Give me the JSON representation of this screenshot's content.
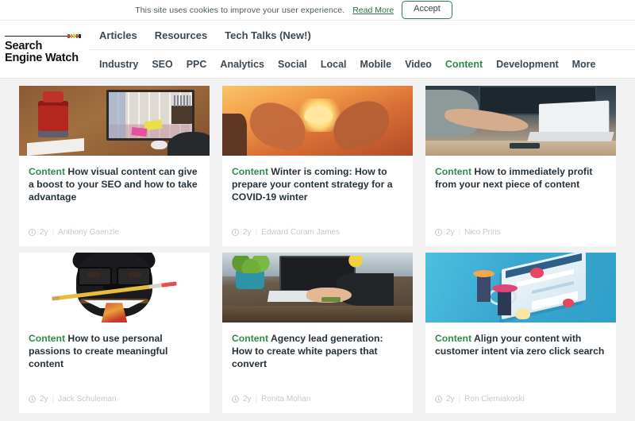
{
  "cookie_bar": {
    "message": "This site uses cookies to improve your user experience.",
    "read_more_label": "Read More",
    "accept_label": "Accept",
    "accent_color": "#2c6e49"
  },
  "header": {
    "logo": {
      "line1": "Search",
      "line2": "Engine Watch",
      "pip_colors": [
        "#d8392c",
        "#e8a02a",
        "#e8c92a",
        "#d8392c",
        "#2b2b2b"
      ]
    },
    "primary_nav": [
      {
        "label": "Articles"
      },
      {
        "label": "Resources"
      },
      {
        "label": "Tech Talks (New!)"
      }
    ],
    "secondary_nav": [
      {
        "label": "Industry",
        "active": false
      },
      {
        "label": "SEO",
        "active": false
      },
      {
        "label": "PPC",
        "active": false
      },
      {
        "label": "Analytics",
        "active": false
      },
      {
        "label": "Social",
        "active": false
      },
      {
        "label": "Local",
        "active": false
      },
      {
        "label": "Mobile",
        "active": false
      },
      {
        "label": "Video",
        "active": false
      },
      {
        "label": "Content",
        "active": true
      },
      {
        "label": "Development",
        "active": false
      },
      {
        "label": "More",
        "active": false
      }
    ],
    "active_color": "#2e8b4f"
  },
  "articles": [
    {
      "category": "Content",
      "title": "How visual content can give a boost to your SEO and how to take advantage",
      "age": "2y",
      "author": "Anthony Gaenzle",
      "thumb": "desk-monitor-robot-photo"
    },
    {
      "category": "Content",
      "title": "Winter is coming: How to prepare your content strategy for a COVID-19 winter",
      "age": "2y",
      "author": "Edward Coram James",
      "thumb": "hands-heart-sunset-photo"
    },
    {
      "category": "Content",
      "title": "How to immediately profit from your next piece of content",
      "age": "2y",
      "author": "Nico Prins",
      "thumb": "person-writing-laptop-photo"
    },
    {
      "category": "Content",
      "title": "How to use personal passions to create meaningful content",
      "age": "2y",
      "author": "Jack Schuleman",
      "thumb": "pug-glasses-pencil-photo"
    },
    {
      "category": "Content",
      "title": "Agency lead generation: How to create white papers that convert",
      "age": "2y",
      "author": "Ronita Mohan",
      "thumb": "laptop-plant-desk-photo"
    },
    {
      "category": "Content",
      "title": "Align your content with customer intent via zero click search",
      "age": "2y",
      "author": "Ron Cierniakoski",
      "thumb": "teal-isometric-search-illustration"
    }
  ],
  "meta_separator": "|"
}
